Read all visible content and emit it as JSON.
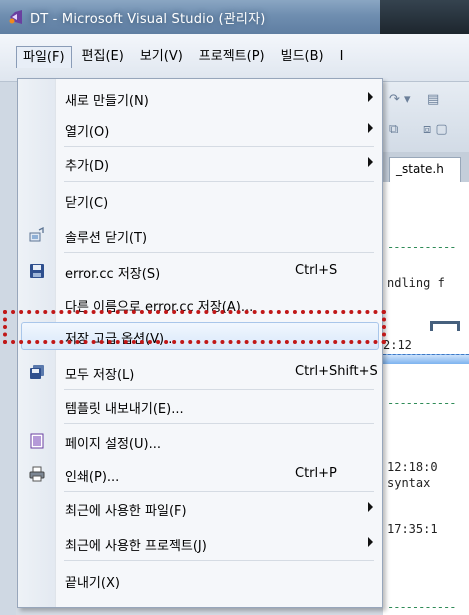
{
  "window": {
    "title": "DT - Microsoft Visual Studio (관리자)",
    "app_icon": "visual-studio-icon"
  },
  "menubar": {
    "items": [
      {
        "label": "파일(F)",
        "active": true
      },
      {
        "label": "편집(E)"
      },
      {
        "label": "보기(V)"
      },
      {
        "label": "프로젝트(P)"
      },
      {
        "label": "빌드(B)"
      },
      {
        "label": "I"
      }
    ]
  },
  "background": {
    "tab_label": "_state.h",
    "code_lines": [
      "ndling f",
      "2:12",
      "12:18:0",
      "syntax",
      "17:35:1"
    ]
  },
  "file_menu": {
    "items": [
      {
        "label": "새로 만들기(N)",
        "submenu": true
      },
      {
        "label": "열기(O)",
        "submenu": true
      },
      {
        "label": "추가(D)",
        "submenu": true
      },
      {
        "label": "닫기(C)"
      },
      {
        "label": "솔루션 닫기(T)",
        "icon": "close-solution-icon"
      },
      {
        "label": "error.cc 저장(S)",
        "shortcut": "Ctrl+S",
        "icon": "save-icon"
      },
      {
        "label": "다른 이름으로 error.cc 저장(A)..."
      },
      {
        "label": "저장 고급 옵션(V)...",
        "highlighted": true
      },
      {
        "label": "모두 저장(L)",
        "shortcut": "Ctrl+Shift+S",
        "icon": "save-all-icon"
      },
      {
        "label": "템플릿 내보내기(E)..."
      },
      {
        "label": "페이지 설정(U)...",
        "icon": "page-setup-icon"
      },
      {
        "label": "인쇄(P)...",
        "shortcut": "Ctrl+P",
        "icon": "print-icon"
      },
      {
        "label": "최근에 사용한 파일(F)",
        "submenu": true
      },
      {
        "label": "최근에 사용한 프로젝트(J)",
        "submenu": true
      },
      {
        "label": "끝내기(X)"
      }
    ]
  },
  "colors": {
    "highlight_border": "#a9c6ea",
    "annotation_red": "#c01818"
  }
}
